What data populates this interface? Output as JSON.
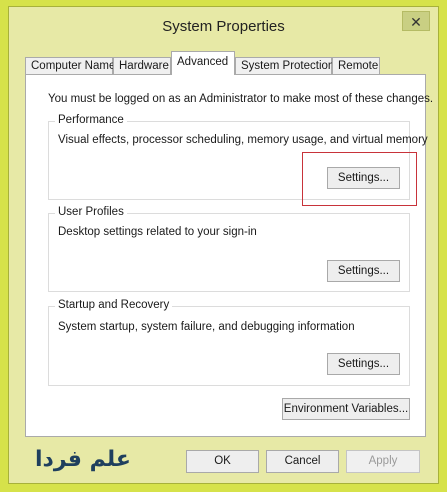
{
  "window": {
    "title": "System Properties",
    "close_glyph": "✕"
  },
  "tabs": [
    {
      "label": "Computer Name",
      "active": false
    },
    {
      "label": "Hardware",
      "active": false
    },
    {
      "label": "Advanced",
      "active": true
    },
    {
      "label": "System Protection",
      "active": false
    },
    {
      "label": "Remote",
      "active": false
    }
  ],
  "admin_notice": "You must be logged on as an Administrator to make most of these changes.",
  "performance": {
    "title": "Performance",
    "description": "Visual effects, processor scheduling, memory usage, and virtual memory",
    "button": "Settings..."
  },
  "user_profiles": {
    "title": "User Profiles",
    "description": "Desktop settings related to your sign-in",
    "button": "Settings..."
  },
  "startup_recovery": {
    "title": "Startup and Recovery",
    "description": "System startup, system failure, and debugging information",
    "button": "Settings..."
  },
  "environment_button": "Environment Variables...",
  "footer": {
    "ok": "OK",
    "cancel": "Cancel",
    "apply": "Apply"
  },
  "watermark": "علم فردا",
  "colors": {
    "highlight": "#c8333a",
    "window_frame": "#e7e9a6",
    "desktop": "#d6e24a"
  }
}
